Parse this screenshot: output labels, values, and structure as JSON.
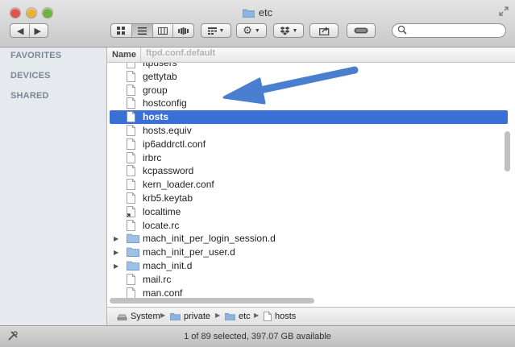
{
  "window": {
    "title": "etc"
  },
  "sidebar": {
    "sections": [
      {
        "label": "FAVORITES"
      },
      {
        "label": "DEVICES"
      },
      {
        "label": "SHARED"
      }
    ]
  },
  "list": {
    "column_header": "Name",
    "ghost_filename": "ftpd.conf.default",
    "rows": [
      {
        "name": "ftpusers",
        "kind": "file",
        "selected": false
      },
      {
        "name": "gettytab",
        "kind": "file",
        "selected": false
      },
      {
        "name": "group",
        "kind": "file",
        "selected": false
      },
      {
        "name": "hostconfig",
        "kind": "file",
        "selected": false
      },
      {
        "name": "hosts",
        "kind": "file",
        "selected": true
      },
      {
        "name": "hosts.equiv",
        "kind": "file",
        "selected": false
      },
      {
        "name": "ip6addrctl.conf",
        "kind": "file",
        "selected": false
      },
      {
        "name": "irbrc",
        "kind": "file",
        "selected": false
      },
      {
        "name": "kcpassword",
        "kind": "file",
        "selected": false
      },
      {
        "name": "kern_loader.conf",
        "kind": "file",
        "selected": false
      },
      {
        "name": "krb5.keytab",
        "kind": "file",
        "selected": false
      },
      {
        "name": "localtime",
        "kind": "alias",
        "selected": false
      },
      {
        "name": "locate.rc",
        "kind": "file",
        "selected": false
      },
      {
        "name": "mach_init_per_login_session.d",
        "kind": "folder",
        "selected": false
      },
      {
        "name": "mach_init_per_user.d",
        "kind": "folder",
        "selected": false
      },
      {
        "name": "mach_init.d",
        "kind": "folder",
        "selected": false
      },
      {
        "name": "mail.rc",
        "kind": "file",
        "selected": false
      },
      {
        "name": "man.conf",
        "kind": "file",
        "selected": false
      }
    ]
  },
  "pathbar": {
    "crumbs": [
      {
        "label": "System",
        "icon": "disk-icon"
      },
      {
        "label": "private",
        "icon": "folder-icon"
      },
      {
        "label": "etc",
        "icon": "folder-icon"
      },
      {
        "label": "hosts",
        "icon": "file-icon"
      }
    ]
  },
  "status": {
    "text": "1 of 89 selected, 397.07 GB available"
  },
  "search": {
    "placeholder": "",
    "value": ""
  },
  "colors": {
    "selection": "#3a6fd6",
    "arrow": "#4a7fd0",
    "sidebar_bg": "#e6eaef"
  }
}
